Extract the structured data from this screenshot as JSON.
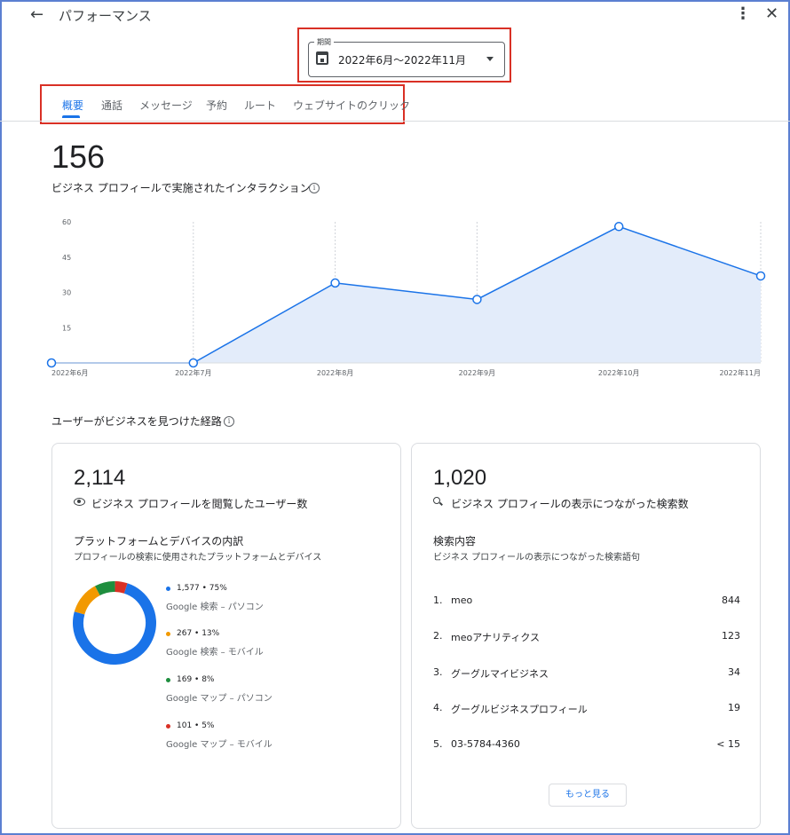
{
  "header": {
    "title": "パフォーマンス",
    "back_icon": "arrow-left-icon",
    "more_icon": "more-vert-icon",
    "close_icon": "close-icon"
  },
  "period": {
    "label": "期間",
    "value": "2022年6月～2022年11月"
  },
  "tabs": [
    {
      "label": "概要",
      "active": true
    },
    {
      "label": "通話"
    },
    {
      "label": "メッセージ"
    },
    {
      "label": "予約"
    },
    {
      "label": "ルート"
    },
    {
      "label": "ウェブサイトのクリック"
    }
  ],
  "summary": {
    "total": "156",
    "description": "ビジネス プロフィールで実施されたインタラクション"
  },
  "chart_data": {
    "type": "area",
    "categories": [
      "2022年6月",
      "2022年7月",
      "2022年8月",
      "2022年9月",
      "2022年10月",
      "2022年11月"
    ],
    "values": [
      0,
      0,
      34,
      27,
      58,
      37
    ],
    "yticks": [
      "15",
      "30",
      "45",
      "60"
    ],
    "ylim": [
      0,
      60
    ],
    "color": "#1a73e8",
    "fill": "#e3ecfa"
  },
  "discovery": {
    "title": "ユーザーがビジネスを見つけた経路"
  },
  "viewers": {
    "count": "2,114",
    "label": "ビジネス プロフィールを閲覧したユーザー数",
    "breakdown_title": "プラットフォームとデバイスの内訳",
    "breakdown_subtitle": "プロフィールの検索に使用されたプラットフォームとデバイス",
    "platforms": [
      {
        "value": "1,577 • 75%",
        "name": "Google 検索 – パソコン",
        "color": "#1a73e8",
        "share": 75
      },
      {
        "value": "267 • 13%",
        "name": "Google 検索 – モバイル",
        "color": "#f29900",
        "share": 13
      },
      {
        "value": "169 • 8%",
        "name": "Google マップ – パソコン",
        "color": "#1e8e3e",
        "share": 8
      },
      {
        "value": "101 • 5%",
        "name": "Google マップ – モバイル",
        "color": "#d93025",
        "share": 5
      }
    ]
  },
  "searches": {
    "count": "1,020",
    "label": "ビジネス プロフィールの表示につながった検索数",
    "list_title": "検索内容",
    "list_subtitle": "ビジネス プロフィールの表示につながった検索語句",
    "queries": [
      {
        "rank": "1.",
        "text": "meo",
        "count": "844"
      },
      {
        "rank": "2.",
        "text": "meoアナリティクス",
        "count": "123"
      },
      {
        "rank": "3.",
        "text": "グーグルマイビジネス",
        "count": "34"
      },
      {
        "rank": "4.",
        "text": "グーグルビジネスプロフィール",
        "count": "19"
      },
      {
        "rank": "5.",
        "text": "03-5784-4360",
        "count": "< 15"
      }
    ],
    "more_label": "もっと見る"
  }
}
